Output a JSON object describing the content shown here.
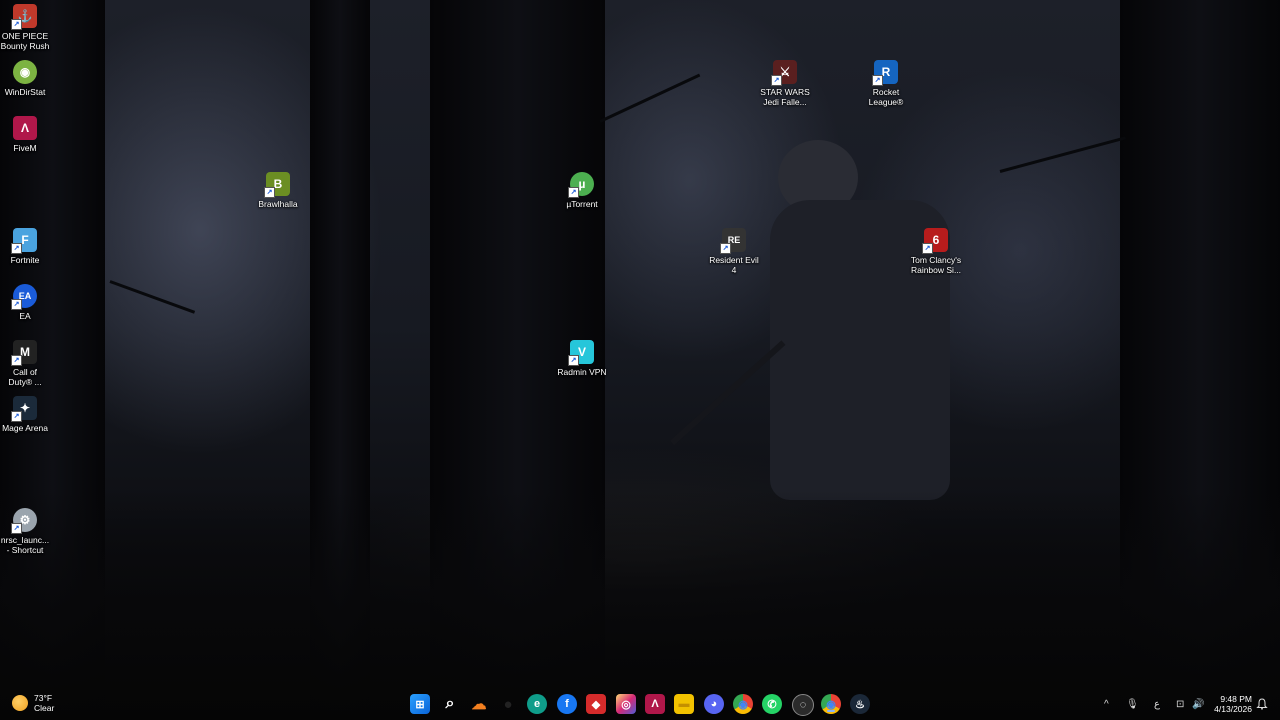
{
  "desktop": {
    "icons": [
      {
        "name": "one-piece-bounty-rush",
        "label": "ONE PIECE\nBounty Rush",
        "color": "#c0392b",
        "glyph": "⚓"
      },
      {
        "name": "windirstat",
        "label": "WinDirStat",
        "color": "#7cb342",
        "glyph": "◉"
      },
      {
        "name": "fivem",
        "label": "FiveM",
        "color": "#b0174a",
        "glyph": "Λ"
      },
      {
        "name": "fortnite",
        "label": "Fortnite",
        "color": "#4aa3df",
        "glyph": "F"
      },
      {
        "name": "ea",
        "label": "EA",
        "color": "#1a5bd8",
        "glyph": "EA"
      },
      {
        "name": "call-of-duty",
        "label": "Call of\nDuty® ...",
        "color": "#222222",
        "glyph": "M"
      },
      {
        "name": "mage-arena",
        "label": "Mage Arena",
        "color": "#1b2a3a",
        "glyph": "✦"
      },
      {
        "name": "nrsc-launcher-shortcut",
        "label": "nrsc_launc...\n- Shortcut",
        "color": "#9aa4ad",
        "glyph": "⚙"
      },
      {
        "name": "brawlhalla",
        "label": "Brawlhalla",
        "color": "#6b8e23",
        "glyph": "B"
      },
      {
        "name": "utorrent",
        "label": "µTorrent",
        "color": "#4caf50",
        "glyph": "µ"
      },
      {
        "name": "radmin-vpn",
        "label": "Radmin VPN",
        "color": "#26c6da",
        "glyph": "V"
      },
      {
        "name": "resident-evil-4",
        "label": "Resident Evil\n4",
        "color": "#333333",
        "glyph": "RE"
      },
      {
        "name": "star-wars-jedi",
        "label": "STAR WARS\nJedi Falle...",
        "color": "#5a1f1f",
        "glyph": "⚔"
      },
      {
        "name": "rocket-league",
        "label": "Rocket\nLeague®",
        "color": "#1565c0",
        "glyph": "R"
      },
      {
        "name": "rainbow-six",
        "label": "Tom Clancy's\nRainbow Si...",
        "color": "#b71c1c",
        "glyph": "6"
      }
    ]
  },
  "taskbar": {
    "weather": {
      "temp": "73°F",
      "condition": "Clear",
      "icon": "sun-moon-icon"
    },
    "apps": [
      {
        "name": "start",
        "glyph": "⊞",
        "color": "#1e90ff"
      },
      {
        "name": "search",
        "glyph": "⌕",
        "color": "transparent"
      },
      {
        "name": "cloudflare",
        "glyph": "☁",
        "color": "#f38020"
      },
      {
        "name": "task-view",
        "glyph": "●",
        "color": "#111111"
      },
      {
        "name": "edge",
        "glyph": "e",
        "color": "#0f9d8a"
      },
      {
        "name": "facebook",
        "glyph": "f",
        "color": "#1877f2"
      },
      {
        "name": "anydesk",
        "glyph": "◆",
        "color": "#d52b2b"
      },
      {
        "name": "instagram",
        "glyph": "◎",
        "color": "#d6249f"
      },
      {
        "name": "fivem",
        "glyph": "Λ",
        "color": "#b0174a"
      },
      {
        "name": "file-explorer",
        "glyph": "▬",
        "color": "#f2c200"
      },
      {
        "name": "discord",
        "glyph": "◕",
        "color": "#5865f2"
      },
      {
        "name": "chrome",
        "glyph": "◉",
        "color": "#ea4335"
      },
      {
        "name": "whatsapp",
        "glyph": "✆",
        "color": "#25d366"
      },
      {
        "name": "obs",
        "glyph": "◌",
        "color": "#2b2b2b"
      },
      {
        "name": "chrome-active",
        "glyph": "◉",
        "color": "#34a853"
      },
      {
        "name": "steam",
        "glyph": "♨",
        "color": "#1b2838"
      }
    ],
    "tray": {
      "chevron": "^",
      "mic": "🎙",
      "lang": "ع",
      "network": "⊡",
      "volume": "🔊"
    },
    "clock": {
      "time": "9:48 PM",
      "date": "4/13/2026"
    }
  }
}
